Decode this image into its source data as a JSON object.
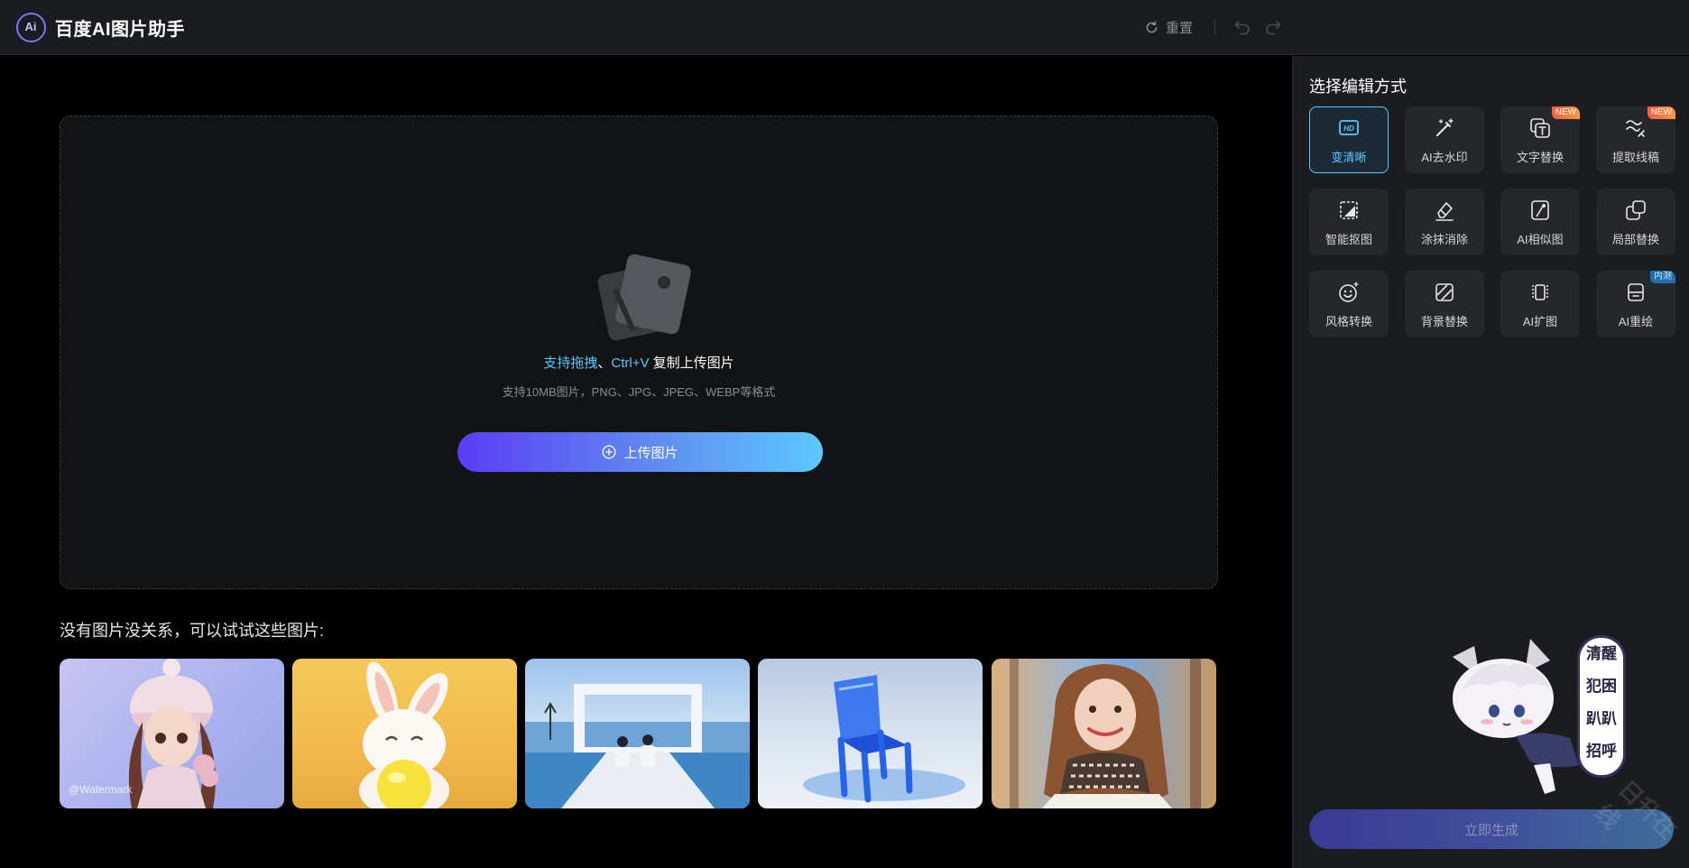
{
  "header": {
    "logo_text": "Ai",
    "title": "百度AI图片助手",
    "reset_label": "重置"
  },
  "upload": {
    "hint_prefix": "支持拖拽",
    "hint_sep": "、",
    "hint_key": "Ctrl+V",
    "hint_suffix": " 复制上传图片",
    "sub_hint": "支持10MB图片，PNG、JPG、JPEG、WEBP等格式",
    "button_label": "上传图片"
  },
  "samples": {
    "title": "没有图片没关系，可以试试这些图片:",
    "watermark": "@Watermark"
  },
  "panel": {
    "title": "选择编辑方式",
    "tools": [
      {
        "label": "变清晰",
        "badge": ""
      },
      {
        "label": "AI去水印",
        "badge": ""
      },
      {
        "label": "文字替换",
        "badge": "NEW"
      },
      {
        "label": "提取线稿",
        "badge": "NEW"
      },
      {
        "label": "智能抠图",
        "badge": ""
      },
      {
        "label": "涂抹消除",
        "badge": ""
      },
      {
        "label": "AI相似图",
        "badge": ""
      },
      {
        "label": "局部替换",
        "badge": ""
      },
      {
        "label": "风格转换",
        "badge": ""
      },
      {
        "label": "背景替换",
        "badge": ""
      },
      {
        "label": "AI扩图",
        "badge": ""
      },
      {
        "label": "AI重绘",
        "badge": "内测"
      }
    ],
    "generate_label": "立即生成"
  },
  "mascot": {
    "sign_lines": [
      "清醒",
      "犯困",
      "趴趴",
      "招呼"
    ],
    "corner_watermark": "日升在线"
  },
  "colors": {
    "accent": "#5cc8ff",
    "brand_gradient_start": "#5b3cf5",
    "panel_bg": "#1b1c1f",
    "badge_new": "#ff5a3c"
  }
}
